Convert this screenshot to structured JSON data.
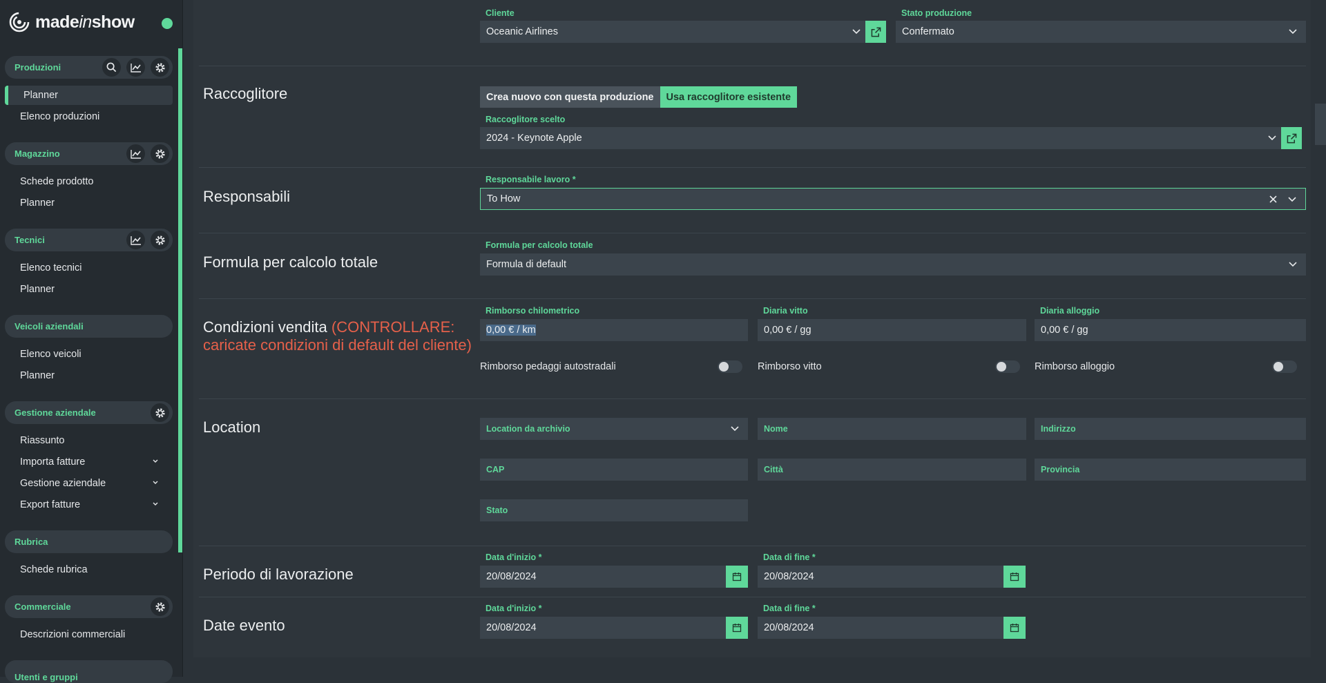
{
  "app": {
    "brand": "madeinshow",
    "brand_plain1": "made",
    "brand_italic": "in",
    "brand_plain2": "show"
  },
  "sidebar": {
    "groups": [
      {
        "title": "Produzioni",
        "icons": [
          "search-icon",
          "chart-icon",
          "gear-icon"
        ],
        "items": [
          "Planner",
          "Elenco produzioni"
        ]
      },
      {
        "title": "Magazzino",
        "icons": [
          "chart-icon",
          "gear-icon"
        ],
        "items": [
          "Schede prodotto",
          "Planner"
        ]
      },
      {
        "title": "Tecnici",
        "icons": [
          "chart-icon",
          "gear-icon"
        ],
        "items": [
          "Elenco tecnici",
          "Planner"
        ]
      },
      {
        "title": "Veicoli aziendali",
        "icons": [],
        "items": [
          "Elenco veicoli",
          "Planner"
        ]
      },
      {
        "title": "Gestione aziendale",
        "icons": [
          "gear-icon"
        ],
        "items": [
          "Riassunto",
          "Importa fatture",
          "Gestione aziendale",
          "Export fatture"
        ]
      },
      {
        "title": "Rubrica",
        "icons": [],
        "items": [
          "Schede rubrica"
        ]
      },
      {
        "title": "Commerciale",
        "icons": [
          "gear-icon"
        ],
        "items": [
          "Descrizioni commerciali"
        ]
      },
      {
        "title": "Utenti e gruppi",
        "icons": [],
        "items": []
      }
    ],
    "active_item": "Planner"
  },
  "form": {
    "cliente": {
      "label": "Cliente",
      "value": "Oceanic Airlines"
    },
    "stato_produzione": {
      "label": "Stato produzione",
      "value": "Confermato"
    },
    "raccoglitore": {
      "title": "Raccoglitore",
      "option_new": "Crea nuovo con questa produzione",
      "option_existing": "Usa raccoglitore esistente",
      "selected_label": "Raccoglitore scelto",
      "selected_value": "2024 - Keynote Apple"
    },
    "responsabili": {
      "title": "Responsabili",
      "label": "Responsabile lavoro *",
      "value": "To How"
    },
    "formula": {
      "title": "Formula per calcolo totale",
      "label": "Formula per calcolo totale",
      "value": "Formula di default"
    },
    "condizioni": {
      "title": "Condizioni vendita",
      "warning_line1": "(CONTROLLARE:",
      "warning_line2": "caricate condizioni di default del cliente)",
      "rimborso_km_label": "Rimborso chilometrico",
      "rimborso_km_value": "0,00 € / km",
      "diaria_vitto_label": "Diaria vitto",
      "diaria_vitto_value": "0,00 € / gg",
      "diaria_alloggio_label": "Diaria alloggio",
      "diaria_alloggio_value": "0,00 € / gg",
      "toggle_pedaggi": "Rimborso pedaggi autostradali",
      "toggle_vitto": "Rimborso vitto",
      "toggle_alloggio": "Rimborso alloggio"
    },
    "location": {
      "title": "Location",
      "archivio": "Location da archivio",
      "nome": "Nome",
      "indirizzo": "Indirizzo",
      "cap": "CAP",
      "citta": "Città",
      "provincia": "Provincia",
      "stato": "Stato"
    },
    "periodo": {
      "title": "Periodo di lavorazione",
      "start_label": "Data d'inizio *",
      "start_value": "20/08/2024",
      "end_label": "Data di fine *",
      "end_value": "20/08/2024"
    },
    "date_evento": {
      "title": "Date evento",
      "start_label": "Data d'inizio *",
      "start_value": "20/08/2024",
      "end_label": "Data di fine *",
      "end_value": "20/08/2024"
    }
  },
  "colors": {
    "accent": "#5fd89a",
    "warning": "#e5604a",
    "background": "#2b3238"
  }
}
